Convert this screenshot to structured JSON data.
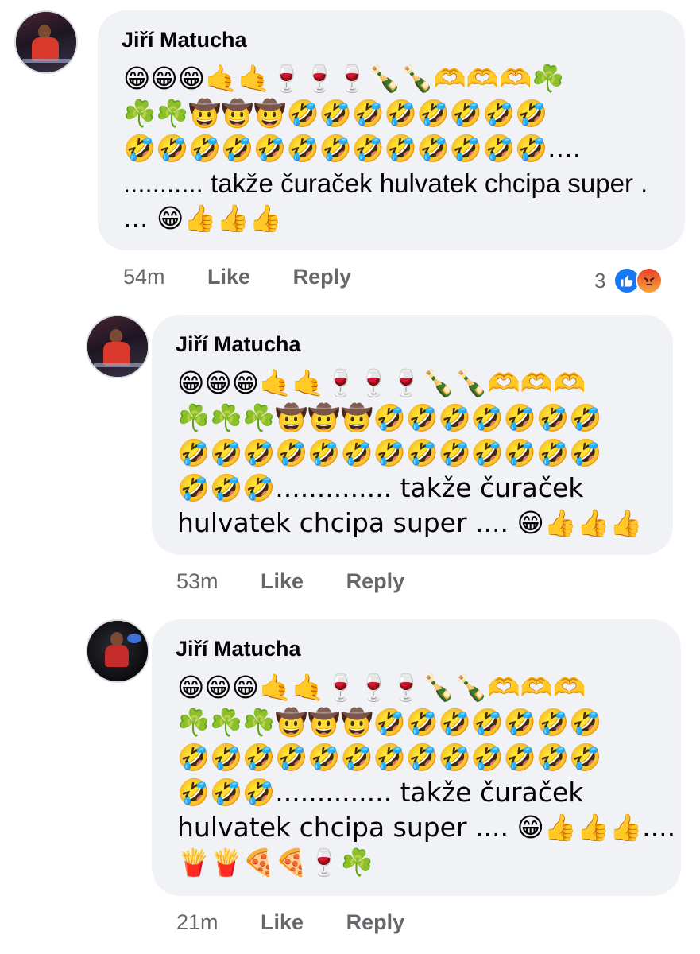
{
  "comments": [
    {
      "author": "Jiří Matucha",
      "lines": [
        "😁😁😁🤙🤙🍷🍷🍷🍾🍾🫶🫶🫶☘️",
        "☘️☘️🤠🤠🤠🤣🤣🤣🤣🤣🤣🤣🤣",
        "🤣🤣🤣🤣🤣🤣🤣🤣🤣🤣🤣🤣🤣....",
        "........... takže čuraček hulvatek chcipa super .",
        "... 😁👍👍👍"
      ],
      "time": "54m",
      "like_label": "Like",
      "reply_label": "Reply",
      "reaction_count": "3",
      "reaction_icons": [
        "like-icon",
        "angry-icon"
      ]
    },
    {
      "author": "Jiří Matucha",
      "lines": [
        "😁😁😁🤙🤙🍷🍷🍷🍾🍾🫶🫶🫶",
        "☘️☘️☘️🤠🤠🤠🤣🤣🤣🤣🤣🤣🤣",
        "🤣🤣🤣🤣🤣🤣🤣🤣🤣🤣🤣🤣🤣",
        "🤣🤣🤣.............. takže čuraček",
        "hulvatek chcipa super .... 😁👍👍👍"
      ],
      "time": "53m",
      "like_label": "Like",
      "reply_label": "Reply"
    },
    {
      "author": "Jiří Matucha",
      "lines": [
        "😁😁😁🤙🤙🍷🍷🍷🍾🍾🫶🫶🫶",
        "☘️☘️☘️🤠🤠🤠🤣🤣🤣🤣🤣🤣🤣",
        "🤣🤣🤣🤣🤣🤣🤣🤣🤣🤣🤣🤣🤣",
        "🤣🤣🤣.............. takže čuraček",
        "hulvatek chcipa super .... 😁👍👍👍....",
        "🍟🍟🍕🍕🍷☘️"
      ],
      "time": "21m",
      "like_label": "Like",
      "reply_label": "Reply"
    }
  ],
  "colors": {
    "bubble": "#f0f2f5",
    "meta_text": "#65676b",
    "like_blue": "#1877f2"
  }
}
